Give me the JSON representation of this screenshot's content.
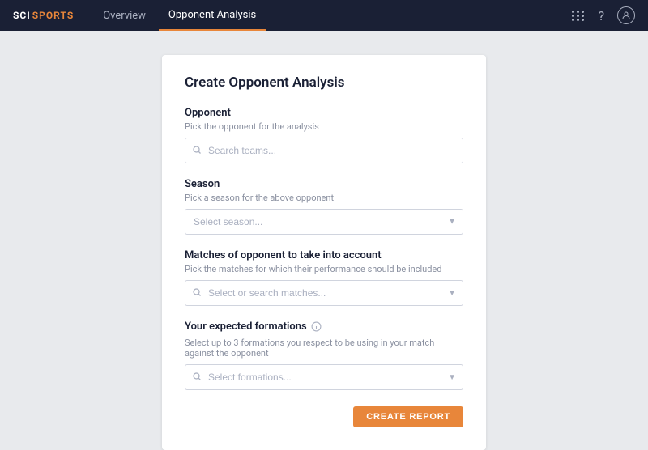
{
  "navbar": {
    "brand_sci": "SCI",
    "brand_sports": "SPORTS",
    "nav_items": [
      {
        "label": "Overview",
        "active": false
      },
      {
        "label": "Opponent Analysis",
        "active": true
      }
    ]
  },
  "card": {
    "title": "Create Opponent Analysis",
    "opponent": {
      "label": "Opponent",
      "description": "Pick the opponent for the analysis",
      "placeholder": "Search teams..."
    },
    "season": {
      "label": "Season",
      "description": "Pick a season for the above opponent",
      "placeholder": "Select season..."
    },
    "matches": {
      "label": "Matches of opponent to take into account",
      "description": "Pick the matches for which their performance should be included",
      "placeholder": "Select or search matches..."
    },
    "formations": {
      "label": "Your expected formations",
      "description": "Select up to 3 formations you respect to be using in your match against the opponent",
      "placeholder": "Select formations..."
    },
    "create_button": "CREATE REPORT"
  }
}
